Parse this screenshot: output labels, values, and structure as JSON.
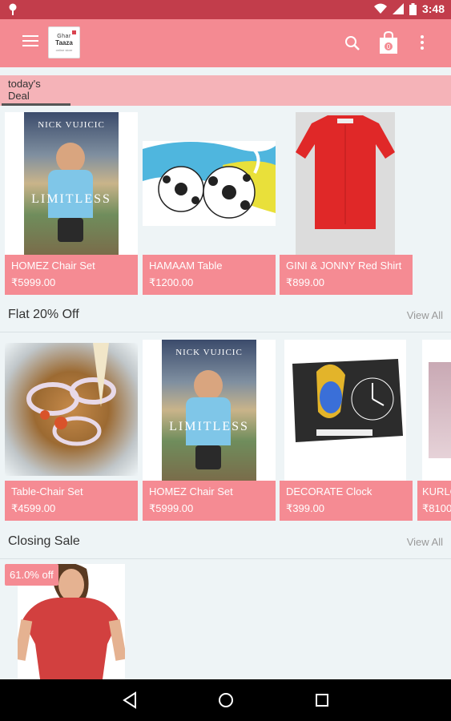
{
  "status": {
    "time": "3:48"
  },
  "toolbar": {
    "logo_line1": "Ghar",
    "logo_line2": "Taaza",
    "logo_line3": "online store",
    "cart_count": "0"
  },
  "deal_tab": {
    "label": "today's Deal"
  },
  "deals": [
    {
      "name": "HOMEZ Chair Set",
      "price": "₹5999.00"
    },
    {
      "name": "HAMAAM Table",
      "price": "₹1200.00"
    },
    {
      "name": "GINI & JONNY Red Shirt",
      "price": "₹899.00"
    }
  ],
  "book": {
    "author": "NICK VUJICIC",
    "title": "LIMITLESS"
  },
  "section_flat": {
    "title": "Flat 20% Off",
    "view_all": "View All"
  },
  "flat_items": [
    {
      "name": "Table-Chair Set",
      "price": "₹4599.00"
    },
    {
      "name": "HOMEZ Chair Set",
      "price": "₹5999.00"
    },
    {
      "name": "DECORATE Clock",
      "price": "₹399.00"
    },
    {
      "name": "KURLO",
      "price": "₹8100"
    }
  ],
  "section_closing": {
    "title": "Closing Sale",
    "view_all": "View All"
  },
  "closing_items": [
    {
      "badge": "61.0% off"
    }
  ],
  "colors": {
    "accent": "#f48a92",
    "status_bar": "#c23d4b",
    "card_info": "#f58b93"
  }
}
